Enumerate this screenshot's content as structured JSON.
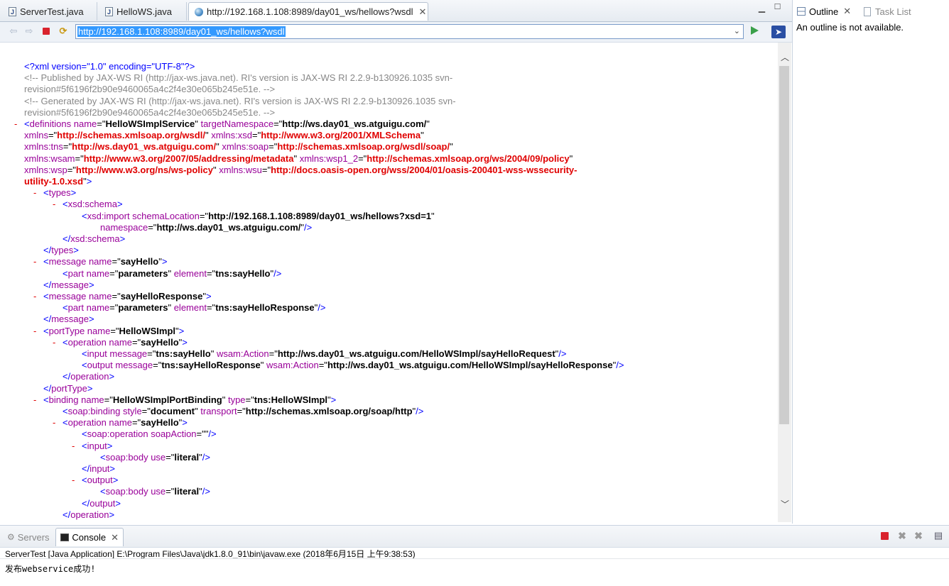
{
  "editor": {
    "tabs": [
      {
        "label": "ServerTest.java",
        "icon": "java-file-icon"
      },
      {
        "label": "HelloWS.java",
        "icon": "java-file-icon"
      },
      {
        "label": "http://192.168.1.108:8989/day01_ws/hellows?wsdl",
        "icon": "globe-icon",
        "active": true
      }
    ],
    "url": "http://192.168.1.108:8989/day01_ws/hellows?wsdl"
  },
  "xml": {
    "decl": "<?xml version=\"1.0\" encoding=\"UTF-8\"?>",
    "comment1a": "<!-- Published by JAX-WS RI (http://jax-ws.java.net). RI's version is JAX-WS RI 2.2.9-b130926.1035 svn-",
    "comment1b": "revision#5f6196f2b90e9460065a4c2f4e30e065b245e51e. -->",
    "comment2a": "<!-- Generated by JAX-WS RI (http://jax-ws.java.net). RI's version is JAX-WS RI 2.2.9-b130926.1035 svn-",
    "comment2b": "revision#5f6196f2b90e9460065a4c2f4e30e065b245e51e. -->",
    "def_name": "HelloWSImplService",
    "def_tns": "http://ws.day01_ws.atguigu.com/",
    "ns_wsdl": "http://schemas.xmlsoap.org/wsdl/",
    "ns_xsd": "http://www.w3.org/2001/XMLSchema",
    "ns_tns": "http://ws.day01_ws.atguigu.com/",
    "ns_soap": "http://schemas.xmlsoap.org/wsdl/soap/",
    "ns_wsam": "http://www.w3.org/2007/05/addressing/metadata",
    "ns_wsp1_2": "http://schemas.xmlsoap.org/ws/2004/09/policy",
    "ns_wsp": "http://www.w3.org/ns/ws-policy",
    "ns_wsu_a": "http://docs.oasis-open.org/wss/2004/01/oasis-200401-wss-wssecurity-",
    "ns_wsu_b": "utility-1.0.xsd",
    "import_loc": "http://192.168.1.108:8989/day01_ws/hellows?xsd=1",
    "import_ns": "http://ws.day01_ws.atguigu.com/",
    "msg1_name": "sayHello",
    "msg1_part": "parameters",
    "msg1_elem": "tns:sayHello",
    "msg2_name": "sayHelloResponse",
    "msg2_part": "parameters",
    "msg2_elem": "tns:sayHelloResponse",
    "porttype_name": "HelloWSImpl",
    "op_name": "sayHello",
    "input_msg": "tns:sayHello",
    "input_action": "http://ws.day01_ws.atguigu.com/HelloWSImpl/sayHelloRequest",
    "output_msg": "tns:sayHelloResponse",
    "output_action": "http://ws.day01_ws.atguigu.com/HelloWSImpl/sayHelloResponse",
    "binding_name": "HelloWSImplPortBinding",
    "binding_type": "tns:HelloWSImpl",
    "soap_style": "document",
    "soap_transport": "http://schemas.xmlsoap.org/soap/http",
    "bop_name": "sayHello",
    "soap_action": "",
    "body_use_in": "literal",
    "body_use_out": "literal"
  },
  "outline": {
    "tabs": [
      {
        "label": "Outline",
        "active": true
      },
      {
        "label": "Task List",
        "active": false
      }
    ],
    "message": "An outline is not available."
  },
  "console": {
    "tabs": [
      {
        "label": "Servers",
        "active": false
      },
      {
        "label": "Console",
        "active": true
      }
    ],
    "label": "ServerTest [Java Application] E:\\Program Files\\Java\\jdk1.8.0_91\\bin\\javaw.exe (2018年6月15日 上午9:38:53)",
    "output": "发布webservice成功!"
  }
}
